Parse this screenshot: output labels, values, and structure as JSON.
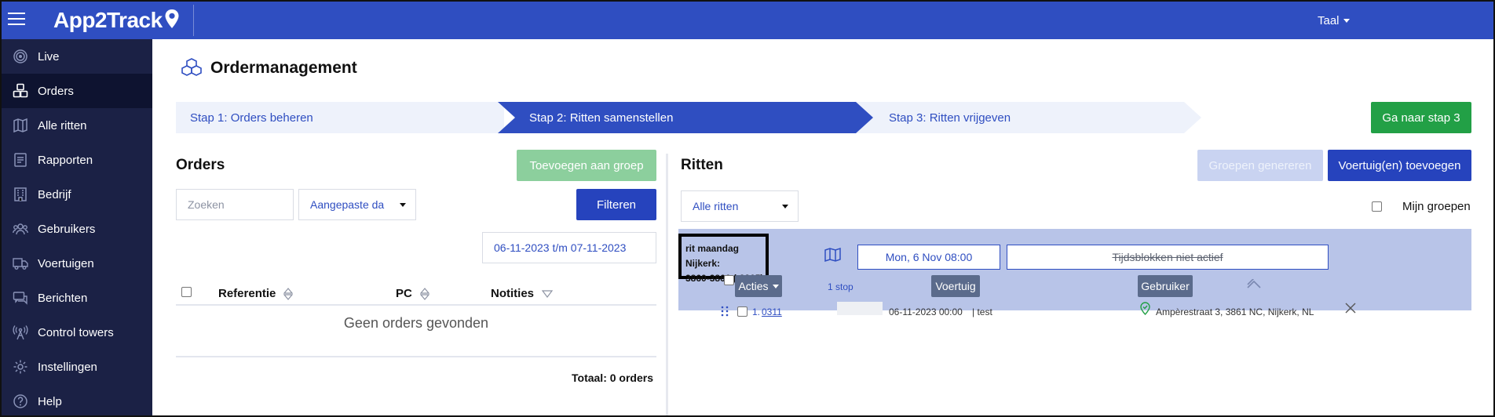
{
  "app": {
    "name": "App2Track",
    "language_label": "Taal"
  },
  "sidebar": {
    "items": [
      {
        "label": "Live",
        "icon": "live-icon"
      },
      {
        "label": "Orders",
        "icon": "orders-icon",
        "active": true
      },
      {
        "label": "Alle ritten",
        "icon": "map-icon"
      },
      {
        "label": "Rapporten",
        "icon": "reports-icon"
      },
      {
        "label": "Bedrijf",
        "icon": "company-icon"
      },
      {
        "label": "Gebruikers",
        "icon": "users-icon"
      },
      {
        "label": "Voertuigen",
        "icon": "truck-icon"
      },
      {
        "label": "Berichten",
        "icon": "messages-icon"
      },
      {
        "label": "Control towers",
        "icon": "tower-icon"
      },
      {
        "label": "Instellingen",
        "icon": "gear-icon"
      },
      {
        "label": "Help",
        "icon": "help-icon"
      }
    ]
  },
  "page": {
    "title": "Ordermanagement"
  },
  "stepper": {
    "step1": "Stap 1: Orders beheren",
    "step2": "Stap 2: Ritten samenstellen",
    "step3": "Stap 3: Ritten vrijgeven",
    "next_button": "Ga naar stap 3"
  },
  "orders": {
    "title": "Orders",
    "add_to_group_button": "Toevoegen aan groep",
    "search_placeholder": "Zoeken",
    "date_filter": "Aangepaste da",
    "filter_button": "Filteren",
    "date_range": "06-11-2023 t/m 07-11-2023",
    "columns": [
      "Referentie",
      "PC",
      "Notities"
    ],
    "empty_message": "Geen orders gevonden",
    "total": "Totaal: 0 orders"
  },
  "ritten": {
    "title": "Ritten",
    "generate_groups_button": "Groepen genereren",
    "add_vehicles_button": "Voertuig(en) toevoegen",
    "filter_select": "Alle ritten",
    "my_groups_label": "Mijn groepen",
    "rit": {
      "name_line1": "rit maandag Nijkerk:",
      "name_line2": "3860-3866 (-3865)",
      "start_date": "Mon, 6 Nov 08:00",
      "time_blocks": "Tijdsblokken niet actief",
      "actions_button": "Acties",
      "stops_count": "1 stop",
      "vehicle_button": "Voertuig",
      "user_button": "Gebruiker",
      "stops": [
        {
          "number": "1.",
          "reference": "0311",
          "datetime": "06-11-2023 00:00",
          "note": "| test",
          "address": "Ampèrestraat 3, 3861 NC, Nijkerk, NL"
        }
      ]
    }
  },
  "colors": {
    "primary": "#2f4ec1",
    "sidebar": "#1b2145",
    "sidebar_active": "#0e1330",
    "success": "#22a046",
    "rit_block": "#b8c4e8"
  }
}
